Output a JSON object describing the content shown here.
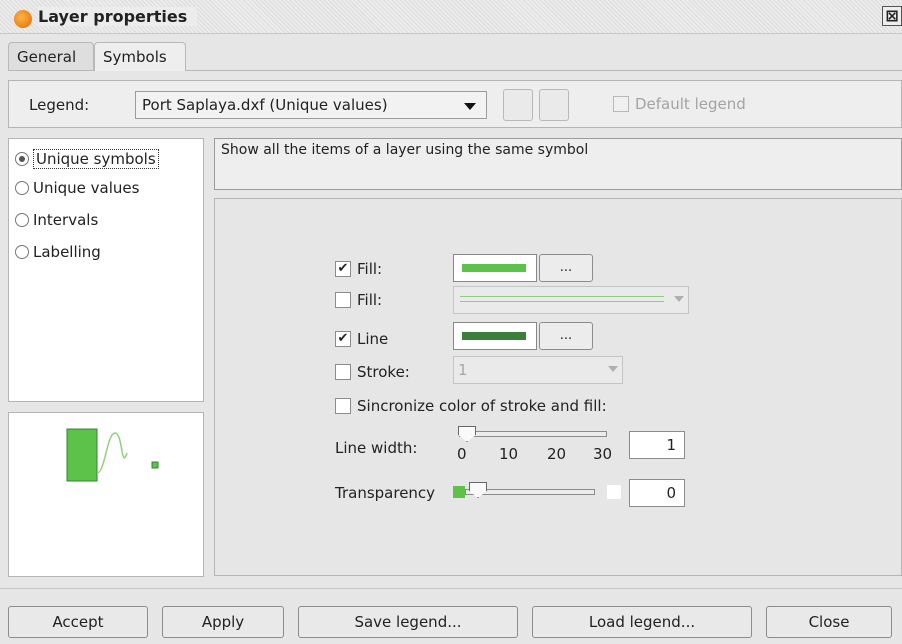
{
  "window": {
    "title": "Layer properties",
    "close_glyph": "⊠"
  },
  "tabs": [
    {
      "label": "General"
    },
    {
      "label": "Symbols"
    }
  ],
  "legend": {
    "label": "Legend:",
    "selected": "Port Saplaya.dxf (Unique values)",
    "default_legend_label": "Default legend"
  },
  "legend_types": [
    {
      "label": "Unique symbols",
      "selected": true
    },
    {
      "label": "Unique values",
      "selected": false
    },
    {
      "label": "Intervals",
      "selected": false
    },
    {
      "label": "Labelling",
      "selected": false
    }
  ],
  "description": "Show all the items of a layer using the same symbol",
  "settings": {
    "fill": {
      "label": "Fill:",
      "checked": true,
      "color": "#5cc24a",
      "button": "..."
    },
    "fill2": {
      "label": "Fill:",
      "checked": false
    },
    "line": {
      "label": "Line",
      "checked": true,
      "color": "#3a7f3a",
      "button": "..."
    },
    "stroke": {
      "label": "Stroke:",
      "checked": false,
      "value": "1"
    },
    "sync": {
      "label": "Sincronize color of stroke and fill:",
      "checked": false
    },
    "line_width": {
      "label": "Line width:",
      "value": "1",
      "ticks": [
        "0",
        "10",
        "20",
        "30"
      ]
    },
    "transparency": {
      "label": "Transparency",
      "value": "0"
    }
  },
  "buttons": {
    "accept": "Accept",
    "apply": "Apply",
    "save": "Save legend...",
    "load": "Load legend...",
    "close": "Close"
  },
  "icons": {
    "app": "gvsig-logo-icon",
    "close": "close-icon",
    "dropdown": "chevron-down-icon"
  },
  "colors": {
    "fill": "#5cc24a",
    "line": "#3a7f3a",
    "preview_fill": "#5cc24a",
    "preview_line": "#8fd07e"
  }
}
